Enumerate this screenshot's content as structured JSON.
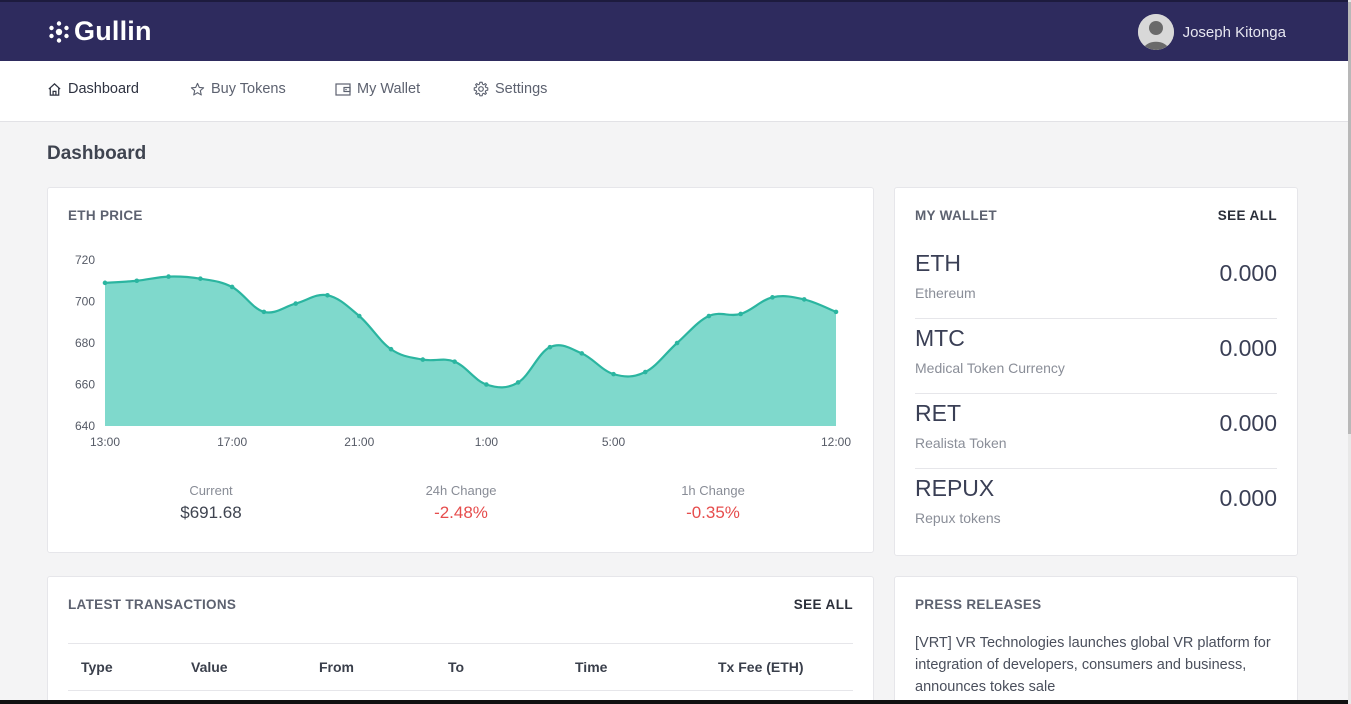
{
  "brand": {
    "name": "Gullin"
  },
  "user": {
    "name": "Joseph Kitonga"
  },
  "nav": {
    "items": [
      {
        "label": "Dashboard",
        "icon": "home-icon"
      },
      {
        "label": "Buy Tokens",
        "icon": "star-icon"
      },
      {
        "label": "My Wallet",
        "icon": "wallet-icon"
      },
      {
        "label": "Settings",
        "icon": "gear-icon"
      }
    ]
  },
  "page": {
    "title": "Dashboard"
  },
  "eth_card": {
    "title": "ETH PRICE",
    "stats": [
      {
        "label": "Current",
        "value": "$691.68"
      },
      {
        "label": "24h Change",
        "value": "-2.48%"
      },
      {
        "label": "1h Change",
        "value": "-0.35%"
      }
    ]
  },
  "chart_data": {
    "type": "area",
    "title": "ETH PRICE",
    "xlabel": "",
    "ylabel": "",
    "ylim": [
      640,
      720
    ],
    "y_ticks": [
      640,
      660,
      680,
      700,
      720
    ],
    "x_tick_labels": [
      "13:00",
      "17:00",
      "21:00",
      "1:00",
      "5:00",
      "12:00"
    ],
    "x_tick_index": [
      0,
      4,
      8,
      12,
      16,
      23
    ],
    "values": [
      709,
      710,
      712,
      711,
      707,
      695,
      699,
      703,
      693,
      677,
      672,
      671,
      660,
      661,
      678,
      675,
      665,
      666,
      680,
      693,
      694,
      702,
      701,
      695
    ],
    "color": "#2bb5a0",
    "fill": "#7fd9cc",
    "grid": false
  },
  "wallet_card": {
    "title": "MY WALLET",
    "see_all": "SEE ALL",
    "items": [
      {
        "symbol": "ETH",
        "name": "Ethereum",
        "balance": "0.000"
      },
      {
        "symbol": "MTC",
        "name": "Medical Token Currency",
        "balance": "0.000"
      },
      {
        "symbol": "RET",
        "name": "Realista Token",
        "balance": "0.000"
      },
      {
        "symbol": "REPUX",
        "name": "Repux tokens",
        "balance": "0.000"
      }
    ]
  },
  "tx_card": {
    "title": "LATEST TRANSACTIONS",
    "see_all": "SEE ALL",
    "columns": [
      "Type",
      "Value",
      "From",
      "To",
      "Time",
      "Tx Fee (ETH)"
    ]
  },
  "press_card": {
    "title": "PRESS RELEASES",
    "text": "[VRT] VR Technologies launches global VR platform for integration of developers, consumers and business, announces tokes sale"
  }
}
